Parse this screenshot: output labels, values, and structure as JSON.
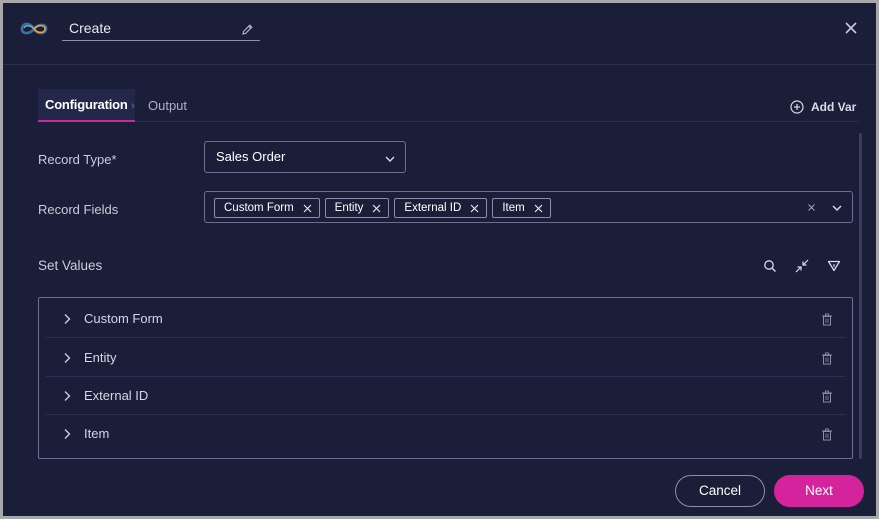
{
  "dialog": {
    "title_value": "Create",
    "icons": {
      "logo": "infinity-logo-icon",
      "edit": "pencil-icon",
      "close": "close-icon"
    }
  },
  "tabs": [
    {
      "label": "Configuration",
      "active": true
    },
    {
      "label": "Output",
      "active": false
    }
  ],
  "tab_separator": "›",
  "add_var": {
    "label": "Add Var",
    "icon": "plus-circle-icon"
  },
  "record_type": {
    "label": "Record Type*",
    "value": "Sales Order"
  },
  "record_fields": {
    "label": "Record Fields",
    "chips": [
      "Custom Form",
      "Entity",
      "External ID",
      "Item"
    ]
  },
  "set_values": {
    "title": "Set Values",
    "tools": [
      "search-icon",
      "collapse-icon",
      "filter-icon"
    ],
    "rows": [
      "Custom Form",
      "Entity",
      "External ID",
      "Item"
    ]
  },
  "footer": {
    "cancel_label": "Cancel",
    "next_label": "Next"
  },
  "colors": {
    "background": "#1b1e38",
    "accent": "#d3249d",
    "border": "#6c7090",
    "divider": "#2d3150"
  }
}
